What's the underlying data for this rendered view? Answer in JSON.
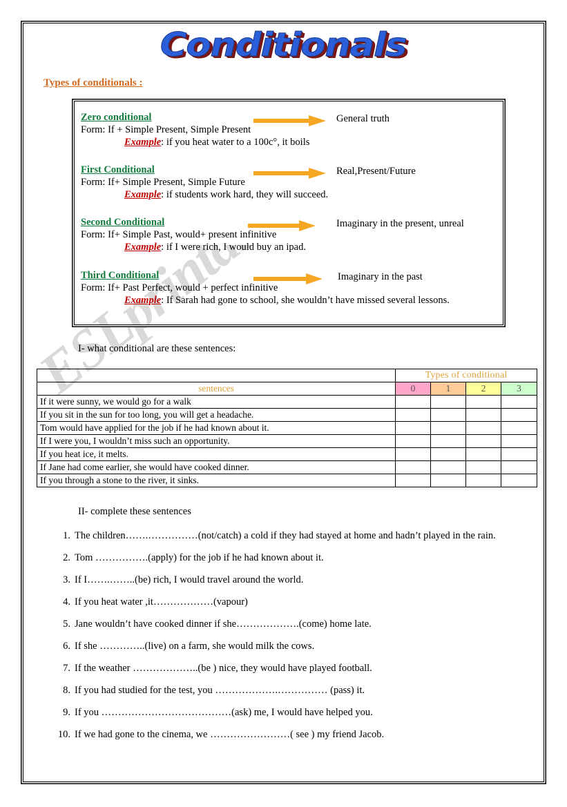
{
  "document": {
    "title": "Conditionals",
    "watermark": "ESLprintables.com"
  },
  "types_section": {
    "heading": "Types of conditionals :",
    "blocks": [
      {
        "name": "Zero conditional",
        "form": "Form:  If + Simple Present, Simple Present",
        "example_label": "Example",
        "example_text": ": if you heat water to a 100c°, it boils",
        "meaning": "General truth"
      },
      {
        "name": "First Conditional",
        "form": "Form: If+ Simple Present, Simple Future",
        "example_label": "Example",
        "example_text": ": if students work hard, they will succeed.",
        "meaning": "Real,Present/Future"
      },
      {
        "name": "Second Conditional",
        "form": "Form: If+ Simple Past, would+ present infinitive",
        "example_label": "Example",
        "example_text": ": if I were rich, I would buy an ipad.",
        "meaning": "Imaginary in the present, unreal"
      },
      {
        "name": "Third Conditional",
        "form": "Form: If+ Past Perfect, would + perfect infinitive",
        "example_label": "Example",
        "example_text": ": If Sarah had gone to school, she wouldn’t have missed several lessons.",
        "meaning": "Imaginary in  the past"
      }
    ]
  },
  "exercise_one": {
    "heading": "I- what conditional are these sentences:",
    "table": {
      "types_header": "Types of conditional",
      "sentences_header": "sentences",
      "type_columns": [
        {
          "label": "0",
          "color": "#FFA6C9"
        },
        {
          "label": "1",
          "color": "#FFCC99"
        },
        {
          "label": "2",
          "color": "#FFFF99"
        },
        {
          "label": "3",
          "color": "#CCFFCC"
        }
      ],
      "rows": [
        "If it were sunny, we would go for a walk",
        "If you sit in the sun for too long, you will get a headache.",
        "Tom would have applied for the job if he had known about it.",
        "If I were you, I wouldn’t miss such an opportunity.",
        "If you heat ice, it melts.",
        "If Jane had come earlier, she would have cooked dinner.",
        "If you through a stone to the river, it sinks."
      ]
    }
  },
  "exercise_two": {
    "heading": "II- complete these sentences",
    "items": [
      {
        "num": "1.",
        "text": "The children…….……………(not/catch) a cold if they had stayed at home and hadn’t played in the rain."
      },
      {
        "num": "2.",
        "text": "Tom …………….(apply) for the job if  he had known about it."
      },
      {
        "num": "3.",
        "text": "If  I…….……..(be) rich, I would travel around the world."
      },
      {
        "num": "4.",
        "text": "If you heat water ,it………………(vapour)"
      },
      {
        "num": "5.",
        "text": "Jane wouldn’t have cooked dinner if she……………….(come) home late."
      },
      {
        "num": "6.",
        "text": "If she …………..(live) on a farm, she would milk the cows."
      },
      {
        "num": "7.",
        "text": "If the weather ………………..(be ) nice, they would have played football."
      },
      {
        "num": "8.",
        "text": "If you had studied for the test, you ……………….…………… (pass) it."
      },
      {
        "num": "9.",
        "text": "If you …………………………………(ask) me, I would have helped you."
      },
      {
        "num": "10.",
        "text": "If we had gone to the cinema, we ……………………( see ) my friend Jacob."
      }
    ]
  },
  "colors": {
    "title_blue": "#2b5fd9",
    "title_shadow": "#7a1717",
    "heading_orange": "#d2691e",
    "conditional_green": "#117a3d",
    "example_red": "#c00000",
    "table_header_gold": "#e0a33c",
    "arrow_orange": "#F5A623"
  }
}
